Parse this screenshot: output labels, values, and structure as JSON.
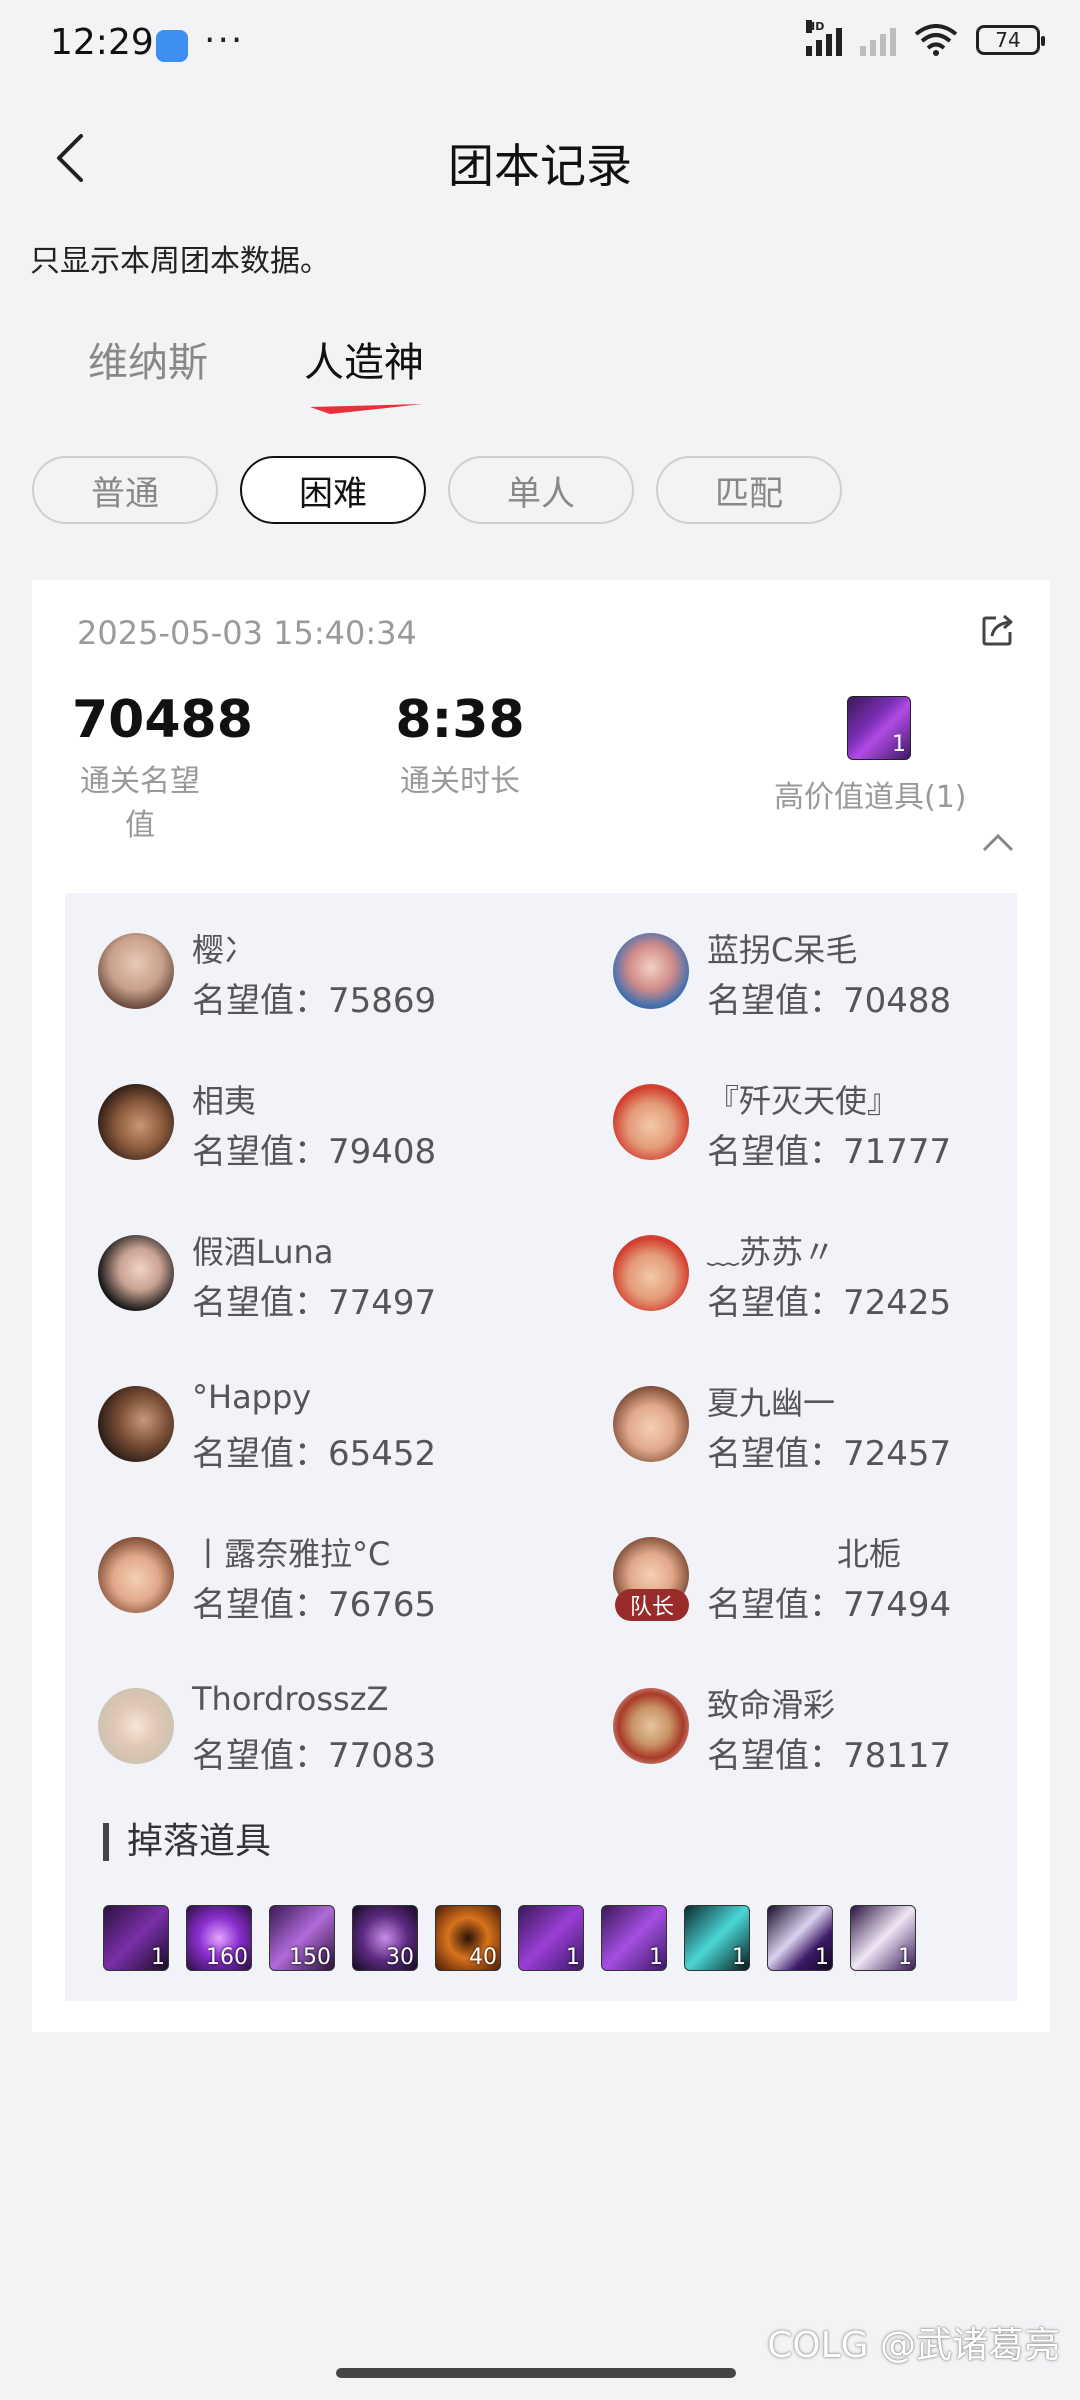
{
  "status": {
    "time": "12:29",
    "dots": "···",
    "hd": "HD",
    "battery": "74"
  },
  "header": {
    "title": "团本记录"
  },
  "notice": "只显示本周团本数据。",
  "tabs": [
    {
      "label": "维纳斯"
    },
    {
      "label": "人造神"
    }
  ],
  "filters": [
    {
      "label": "普通"
    },
    {
      "label": "困难"
    },
    {
      "label": "单人"
    },
    {
      "label": "匹配"
    }
  ],
  "record": {
    "datetime": "2025-05-03 15:40:34",
    "reputation": {
      "value": "70488",
      "label": "通关名望值"
    },
    "duration": {
      "value": "8:38",
      "label": "通关时长"
    },
    "high_value": {
      "label": "高价值道具(1)",
      "count": "1"
    }
  },
  "members": [
    {
      "name": "樱冫",
      "rep": "名望值：75869"
    },
    {
      "name": "蓝拐C呆毛",
      "rep": "名望值：70488"
    },
    {
      "name": "相夷",
      "rep": "名望值：79408"
    },
    {
      "name": "『歼灭天使』",
      "rep": "名望值：71777"
    },
    {
      "name": "假酒Luna",
      "rep": "名望值：77497"
    },
    {
      "name": "﹏苏苏〃",
      "rep": "名望值：72425"
    },
    {
      "name": "°Happy",
      "rep": "名望值：65452"
    },
    {
      "name": "夏九幽一",
      "rep": "名望值：72457"
    },
    {
      "name": "丨露奈雅拉°C",
      "rep": "名望值：76765"
    },
    {
      "name": "北栀",
      "rep": "名望值：77494",
      "badge": "队长"
    },
    {
      "name": "ThordrosszZ",
      "rep": "名望值：77083"
    },
    {
      "name": "致命滑彩",
      "rep": "名望值：78117"
    }
  ],
  "drops": {
    "title": "掉落道具",
    "items": [
      {
        "count": "1"
      },
      {
        "count": "160"
      },
      {
        "count": "150"
      },
      {
        "count": "30"
      },
      {
        "count": "40"
      },
      {
        "count": "1"
      },
      {
        "count": "1"
      },
      {
        "count": "1"
      },
      {
        "count": "1"
      },
      {
        "count": "1"
      }
    ]
  },
  "watermark": "COLG @武诸葛亮",
  "colors": {
    "accent": "#e8303a",
    "background": "#f3f3f6",
    "card": "#ffffff",
    "inner": "#f2f3f8"
  }
}
